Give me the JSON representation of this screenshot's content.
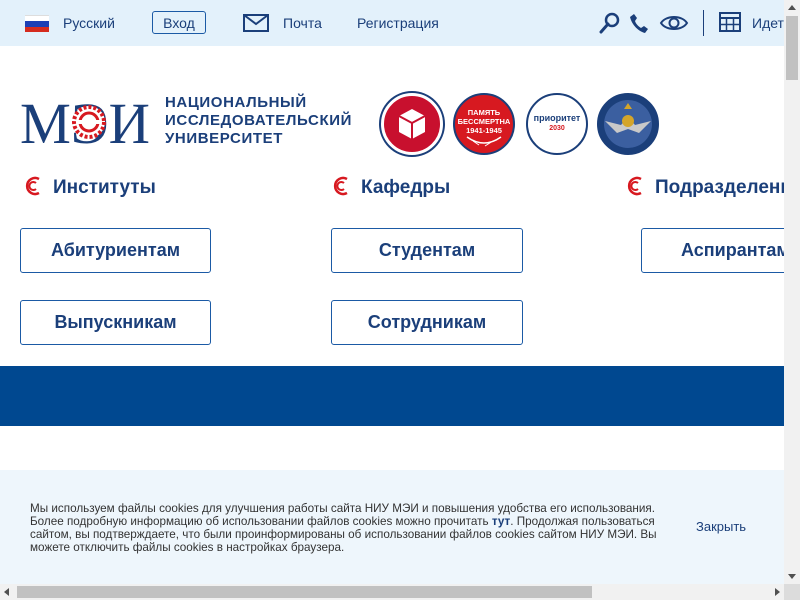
{
  "topbar": {
    "language": "Русский",
    "login": "Вход",
    "mail": "Почта",
    "register": "Регистрация",
    "truncated_item": "Идет"
  },
  "logo": {
    "mark": "МЭИ",
    "line1": "НАЦИОНАЛЬНЫЙ",
    "line2": "ИССЛЕДОВАТЕЛЬСКИЙ",
    "line3": "УНИВЕРСИТЕТ"
  },
  "badges": {
    "memory": {
      "line1": "ПАМЯТЬ",
      "line2": "БЕССМЕРТНА",
      "line3": "1941-1945"
    },
    "priority": {
      "line1": "приоритет",
      "line2": "2030"
    }
  },
  "sections": {
    "institutes": "Институты",
    "departments": "Кафедры",
    "divisions": "Подразделения"
  },
  "audience": {
    "applicants": "Абитуриентам",
    "students": "Студентам",
    "postgrads": "Аспирантам",
    "graduates": "Выпускникам",
    "staff": "Сотрудникам"
  },
  "cookie": {
    "text_before": "Мы используем файлы cookies для улучшения работы сайта НИУ МЭИ и повышения удобства его использования. Более подробную информацию об использовании файлов cookies можно прочитать ",
    "link": "тут",
    "text_after": ". Продолжая пользоваться сайтом, вы подтверждаете, что были проинформированы об использовании файлов cookies сайтом НИУ МЭИ. Вы можете отключить файлы cookies в настройках браузера.",
    "accept": "Закрыть"
  },
  "colors": {
    "brand_blue": "#1b3f7a",
    "band_blue": "#004890",
    "accent_red": "#d71920",
    "topbar_bg": "#e3f1fb"
  }
}
